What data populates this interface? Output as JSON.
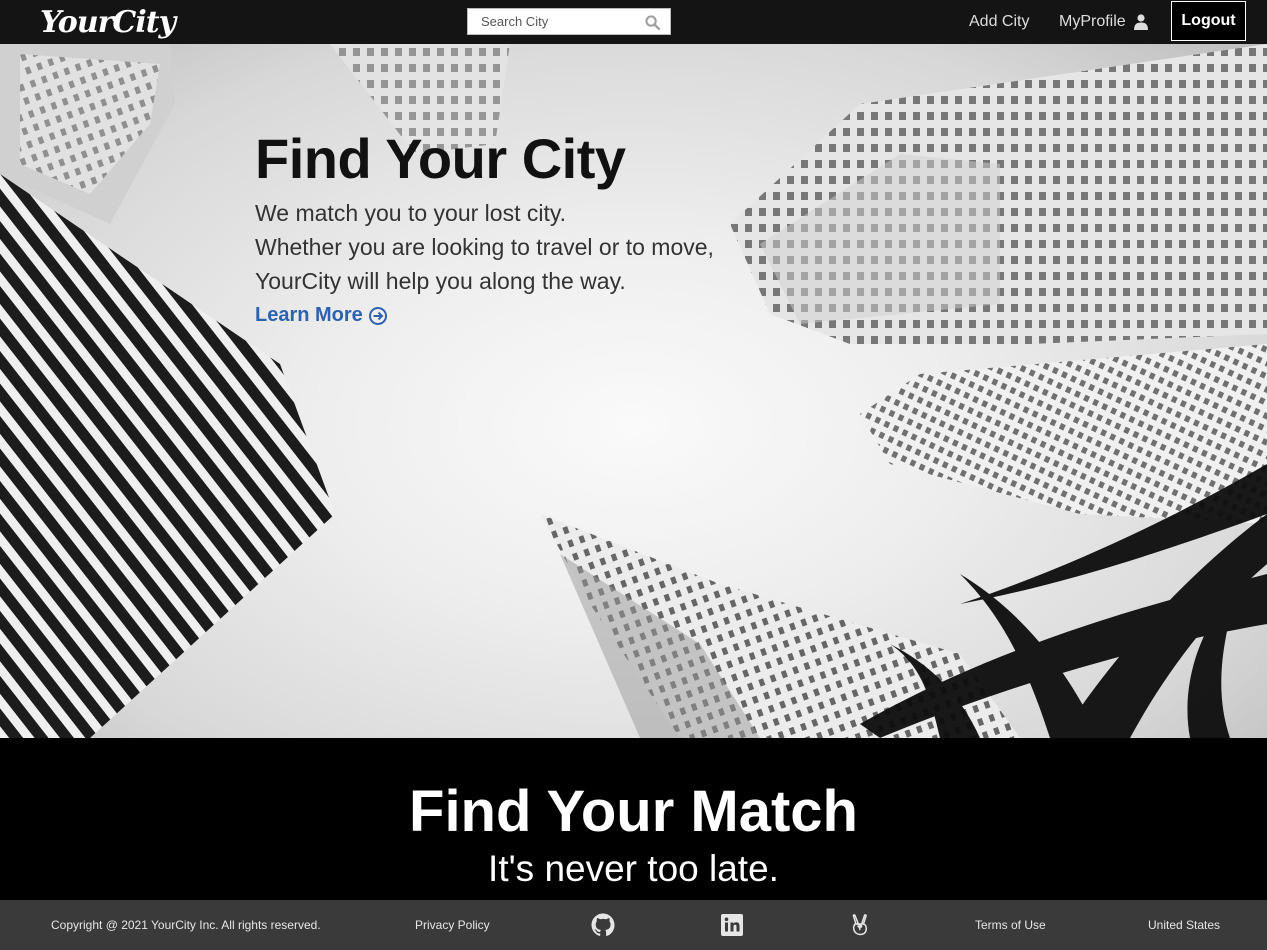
{
  "nav": {
    "brand": "YourCity",
    "search_placeholder": "Search City",
    "add_city": "Add City",
    "my_profile": "MyProfile",
    "logout": "Logout"
  },
  "hero": {
    "title": "Find Your City",
    "lines": [
      "We match you to your lost city.",
      "Whether you are looking to travel or to move,",
      "YourCity will help you along the way."
    ],
    "cta": "Learn More"
  },
  "match": {
    "title": "Find Your Match",
    "subtitle": "It's never too late."
  },
  "footer": {
    "copyright": "Copyright @ 2021 YourCity Inc. All rights reserved.",
    "privacy": "Privacy Policy",
    "social_icons": [
      "github-icon",
      "linkedin-icon",
      "angellist-icon"
    ],
    "terms": "Terms of Use",
    "country": "United States"
  },
  "colors": {
    "nav_bg": "#141414",
    "link_blue": "#2c62b0",
    "footer_bg": "#3a3a3a"
  }
}
